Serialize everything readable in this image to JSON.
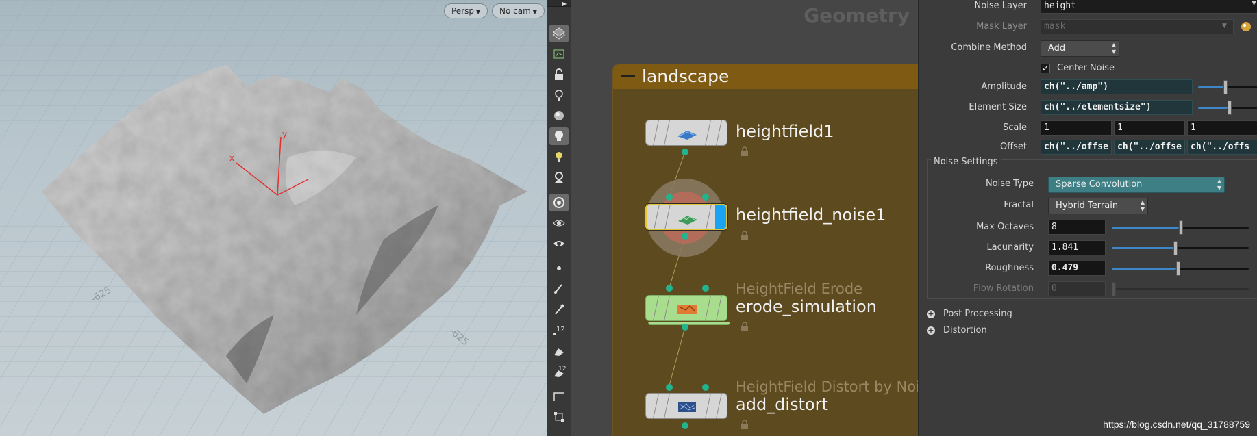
{
  "viewport": {
    "camera_view": "Persp",
    "camera_select": "No cam",
    "grid_labels": [
      "-625",
      "-625"
    ],
    "axis_labels": {
      "x": "x",
      "y": "y"
    }
  },
  "shelf": {
    "tools": [
      "display-options-icon",
      "visualizer-icon",
      "lock-icon",
      "ghost-icon",
      "shading-icon",
      "light-bulb-icon",
      "headlight-icon",
      "camera-light-icon",
      "render-view-icon",
      "visibility-icon",
      "visibility-alt-icon",
      "point-icon",
      "brush-icon",
      "dropper-icon",
      "number-12-icon",
      "paint-icon",
      "number-12-alt-icon",
      "curve-icon",
      "transform-icon"
    ]
  },
  "network": {
    "context_title": "Geometry",
    "subnet_title": "landscape",
    "nodes": [
      {
        "name": "heightfield1",
        "type": ""
      },
      {
        "name": "heightfield_noise1",
        "type": ""
      },
      {
        "name": "erode_simulation",
        "type": "HeightField Erode"
      },
      {
        "name": "add_distort",
        "type": "HeightField Distort by Noise"
      }
    ]
  },
  "params": {
    "noise_layer": {
      "label": "Noise Layer",
      "value": "height"
    },
    "mask_layer": {
      "label": "Mask Layer",
      "value": "mask"
    },
    "combine_method": {
      "label": "Combine Method",
      "value": "Add"
    },
    "center_noise": {
      "label": "Center Noise",
      "checked": true
    },
    "amplitude": {
      "label": "Amplitude",
      "value": "ch(\"../amp\")",
      "slider": 0.45
    },
    "element_size": {
      "label": "Element Size",
      "value": "ch(\"../elementsize\")",
      "slider": 0.52
    },
    "scale": {
      "label": "Scale",
      "values": [
        "1",
        "1",
        "1"
      ]
    },
    "offset": {
      "label": "Offset",
      "values": [
        "ch(\"../offse",
        "ch(\"../offse",
        "ch(\"../offs"
      ]
    },
    "noise_settings": {
      "title": "Noise Settings",
      "noise_type": {
        "label": "Noise Type",
        "value": "Sparse Convolution"
      },
      "fractal": {
        "label": "Fractal",
        "value": "Hybrid Terrain"
      },
      "max_octaves": {
        "label": "Max Octaves",
        "value": "8",
        "slider": 0.49
      },
      "lacunarity": {
        "label": "Lacunarity",
        "value": "1.841",
        "slider": 0.45
      },
      "roughness": {
        "label": "Roughness",
        "value": "0.479",
        "slider": 0.47
      },
      "flow_rotation": {
        "label": "Flow Rotation",
        "value": "0"
      }
    },
    "folders": [
      "Post Processing",
      "Distortion"
    ]
  },
  "watermark": "https://blog.csdn.net/qq_31788759",
  "colors": {
    "subnet": "#5d4a1f",
    "subnet_header": "#7e5a12",
    "expr_field": "#21363a",
    "noise_type_menu": "#3e7f86",
    "port": "#22b48f"
  }
}
